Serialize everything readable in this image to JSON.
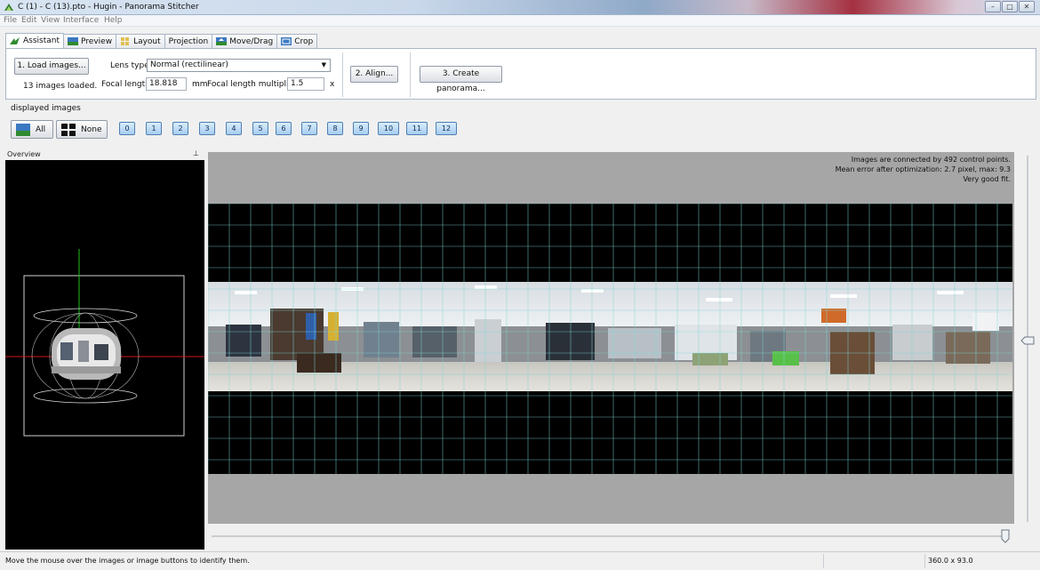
{
  "window": {
    "title": "C (1) - C (13).pto - Hugin - Panorama Stitcher",
    "buttons": [
      "–",
      "□",
      "✕"
    ]
  },
  "menu": [
    "File",
    "Edit",
    "View",
    "Interface",
    "Help"
  ],
  "tabs": [
    {
      "label": "Assistant",
      "icon": "assistant-icon",
      "active": true
    },
    {
      "label": "Preview",
      "icon": "preview-icon"
    },
    {
      "label": "Layout",
      "icon": "layout-icon"
    },
    {
      "label": "Projection"
    },
    {
      "label": "Move/Drag",
      "icon": "move-drag-icon"
    },
    {
      "label": "Crop",
      "icon": "crop-icon"
    }
  ],
  "assistant": {
    "load_button": "1. Load images...",
    "images_loaded": "13 images loaded.",
    "lens_type_label": "Lens type:",
    "lens_type_value": "Normal (rectilinear)",
    "focal_length_label": "Focal length:",
    "focal_length_value": "18.818",
    "focal_unit": "mm",
    "multiplier_label": "Focal length multiplier:",
    "multiplier_value": "1.5",
    "multiplier_unit": "x",
    "align_button": "2. Align...",
    "create_button": "3. Create panorama..."
  },
  "displayed_images": {
    "label": "displayed images",
    "all_label": "All",
    "none_label": "None",
    "image_buttons": [
      "0",
      "1",
      "2",
      "3",
      "4",
      "5",
      "6",
      "7",
      "8",
      "9",
      "10",
      "11",
      "12"
    ]
  },
  "overview": {
    "title": "Overview",
    "pin_icon": "pin-icon"
  },
  "preview": {
    "stats": [
      "Images are connected by 492 control points.",
      "Mean error after optimization: 2.7 pixel, max: 9.3",
      "Very good fit."
    ]
  },
  "status": {
    "hint": "Move the mouse over the images or image buttons to identify them.",
    "fov": "360.0 x 93.0"
  },
  "colors": {
    "grid": "#7fd8d8",
    "accent_button": "#a6cdef",
    "panorama_background": "#000000",
    "preview_background": "#a6a6a6"
  }
}
